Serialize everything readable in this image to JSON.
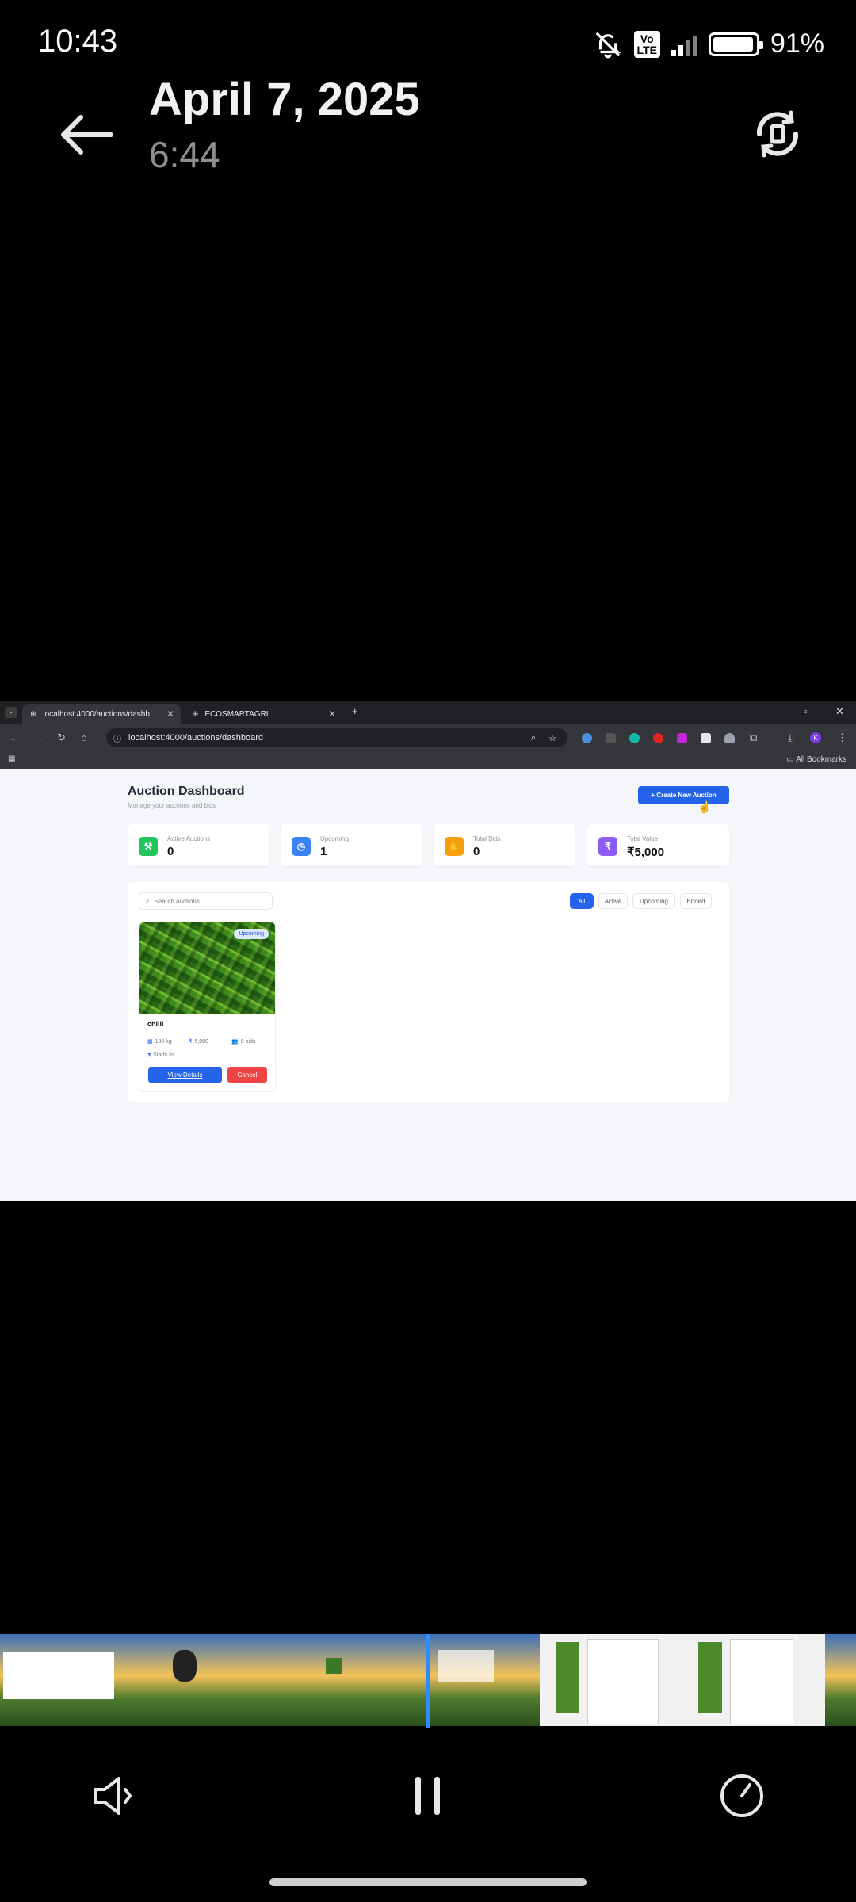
{
  "status_bar": {
    "time": "10:43",
    "battery": "91%",
    "volte_line1": "Vo",
    "volte_line2": "LTE"
  },
  "header": {
    "date": "April 7, 2025",
    "time": "6:44"
  },
  "browser": {
    "tab_active": "localhost:4000/auctions/dashb",
    "tab_other": "ECOSMARTAGRI",
    "url": "localhost:4000/auctions/dashboard",
    "bookmarks_label": "All Bookmarks",
    "profile_initial": "K"
  },
  "dashboard": {
    "title": "Auction Dashboard",
    "subtitle": "Manage your auctions and bids",
    "create_button": "+ Create New Auction",
    "stats": [
      {
        "label": "Active Auctions",
        "value": "0",
        "color": "#22c55e",
        "icon": "gavel-icon"
      },
      {
        "label": "Upcoming",
        "value": "1",
        "color": "#3b82f6",
        "icon": "clock-icon"
      },
      {
        "label": "Total Bids",
        "value": "0",
        "color": "#f59e0b",
        "icon": "hand-icon"
      },
      {
        "label": "Total Value",
        "value": "₹5,000",
        "color": "#8b5cf6",
        "icon": "rupee-icon"
      }
    ],
    "search_placeholder": "Search auctions...",
    "filters": [
      "All",
      "Active",
      "Upcoming",
      "Ended"
    ],
    "selected_filter": "All"
  },
  "auction_card": {
    "badge": "Upcoming",
    "name": "chilli",
    "quantity": "100 kg",
    "price": "5,000",
    "bids": "0 bids",
    "starts": "Starts In:",
    "view_button": "View Details",
    "cancel_button": "Cancel"
  }
}
